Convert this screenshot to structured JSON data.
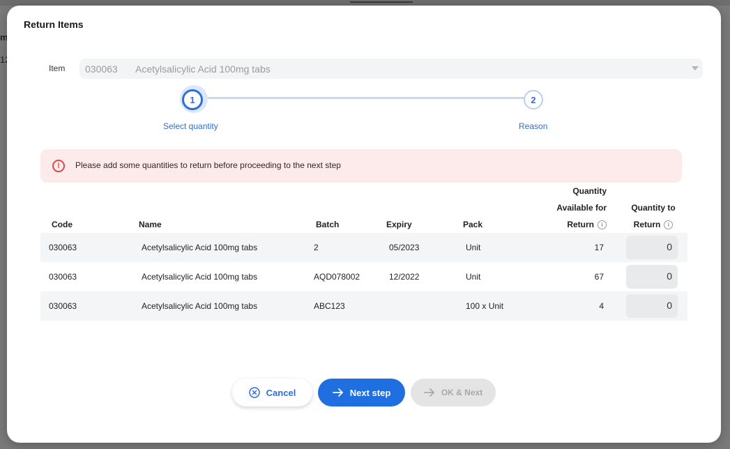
{
  "modal": {
    "title": "Return Items"
  },
  "item": {
    "label": "Item",
    "code": "030063",
    "name": "Acetylsalicylic Acid 100mg tabs"
  },
  "stepper": {
    "steps": [
      {
        "number": "1",
        "label": "Select quantity",
        "state": "active"
      },
      {
        "number": "2",
        "label": "Reason",
        "state": "pending"
      }
    ]
  },
  "alert": {
    "icon": "exclamation-circle-icon",
    "message": "Please add some quantities to return before proceeding to the next step"
  },
  "table": {
    "headers": {
      "code": "Code",
      "name": "Name",
      "batch": "Batch",
      "expiry": "Expiry",
      "pack": "Pack",
      "available_line1": "Quantity",
      "available_line2": "Available for",
      "available_line3": "Return",
      "return_line1": "Quantity to",
      "return_line2": "Return"
    },
    "rows": [
      {
        "code": "030063",
        "name": "Acetylsalicylic Acid 100mg tabs",
        "batch": "2",
        "expiry": "05/2023",
        "pack": "Unit",
        "available": "17",
        "quantity_to_return": "0"
      },
      {
        "code": "030063",
        "name": "Acetylsalicylic Acid 100mg tabs",
        "batch": "AQD078002",
        "expiry": "12/2022",
        "pack": "Unit",
        "available": "67",
        "quantity_to_return": "0"
      },
      {
        "code": "030063",
        "name": "Acetylsalicylic Acid 100mg tabs",
        "batch": "ABC123",
        "expiry": "",
        "pack": "100 x Unit",
        "available": "4",
        "quantity_to_return": "0"
      }
    ]
  },
  "buttons": {
    "cancel": "Cancel",
    "next": "Next step",
    "ok_next": "OK & Next"
  },
  "background": {
    "fragment1": "m",
    "fragment2": "12"
  },
  "colors": {
    "primary": "#1f6fe0",
    "alert_bg": "#fdeaea",
    "alert_icon": "#e04646",
    "disabled": "#e4e4e4"
  }
}
